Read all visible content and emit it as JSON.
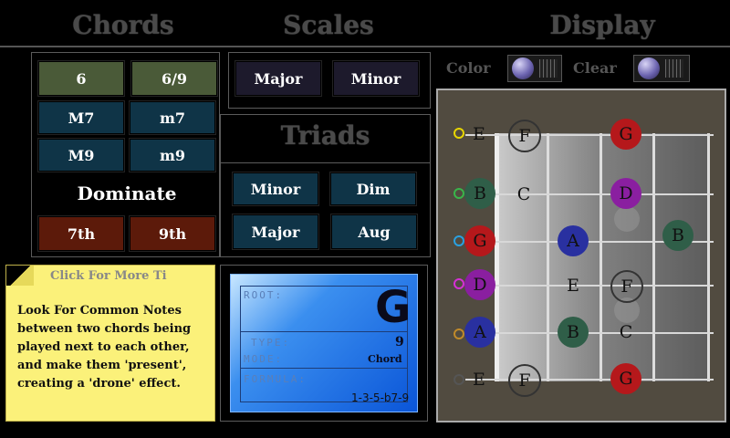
{
  "headers": {
    "chords": "Chords",
    "scales": "Scales",
    "display": "Display"
  },
  "chords": {
    "row1": [
      "6",
      "6/9"
    ],
    "row2": [
      "M7",
      "m7"
    ],
    "row3": [
      "M9",
      "m9"
    ],
    "dominate": "Dominate",
    "row4": [
      "7th",
      "9th"
    ]
  },
  "scales": {
    "major": "Major",
    "minor": "Minor"
  },
  "triads": {
    "title": "Triads",
    "minor": "Minor",
    "dim": "Dim",
    "major": "Major",
    "aug": "Aug"
  },
  "tip": {
    "title": "Click For More Ti",
    "body": "Look For Common Notes between two chords being played next to each other, and make them 'present', creating a 'drone' effect."
  },
  "info": {
    "root_label": "ROOT:",
    "root": "G",
    "type_label": "TYPE:",
    "type": "9",
    "mode_label": "MODE:",
    "mode": "Chord",
    "formula_label": "FORMULA:",
    "formula": "1-3-5-b7-9"
  },
  "display": {
    "color_label": "Color",
    "clear_label": "Clear"
  },
  "fretboard": {
    "strings": [
      "E",
      "B",
      "G",
      "D",
      "A",
      "E"
    ],
    "string_marker_colors": [
      "#e8d600",
      "#39b54a",
      "#2aa0e0",
      "#d630d6",
      "#c08a2a",
      "#555555"
    ],
    "notes": [
      {
        "name": "F",
        "style": "ring"
      },
      {
        "name": "G",
        "color": "#b5181b"
      },
      {
        "name": "B",
        "color": "#2f5e48"
      },
      {
        "name": "C",
        "style": "plain"
      },
      {
        "name": "D",
        "color": "#8a1fa0"
      },
      {
        "name": "G",
        "color": "#b5181b"
      },
      {
        "name": "A",
        "color": "#2930a0"
      },
      {
        "name": "B",
        "color": "#2f5e48"
      },
      {
        "name": "D",
        "color": "#8a1fa0"
      },
      {
        "name": "E",
        "style": "plain"
      },
      {
        "name": "F",
        "style": "ring"
      },
      {
        "name": "A",
        "color": "#2930a0"
      },
      {
        "name": "B",
        "color": "#2f5e48"
      },
      {
        "name": "C",
        "style": "plain"
      },
      {
        "name": "F",
        "style": "ring"
      },
      {
        "name": "G",
        "color": "#b5181b"
      }
    ]
  }
}
